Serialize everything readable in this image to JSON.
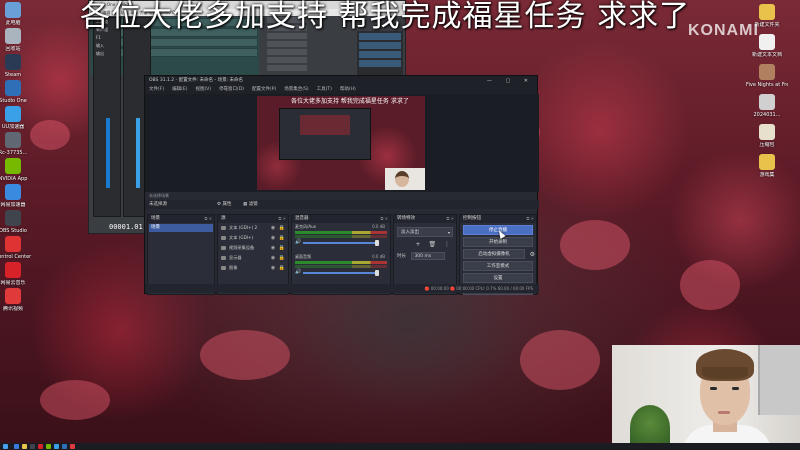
{
  "overlay": {
    "banner_text": "各位大佬多加支持 帮我完成福星任务 求求了",
    "watermark": "KONAMI"
  },
  "desktop_icons_left": [
    {
      "label": "此电脑",
      "icon": "computer-icon",
      "color": "#6aa0d8"
    },
    {
      "label": "回收站",
      "icon": "recycle-bin-icon",
      "color": "#aab4be"
    },
    {
      "label": "Steam",
      "icon": "steam-icon",
      "color": "#2a3a55"
    },
    {
      "label": "Studio One",
      "icon": "studio-one-icon",
      "color": "#2f6fb8"
    },
    {
      "label": "UU加速器",
      "icon": "uu-icon",
      "color": "#3aa0e8"
    },
    {
      "label": "Rc-37735...",
      "icon": "rc-icon",
      "color": "#606874"
    },
    {
      "label": "NVIDIA App",
      "icon": "nvidia-icon",
      "color": "#76b900"
    },
    {
      "label": "网易加速器",
      "icon": "accelerator-icon",
      "color": "#3a8ae0"
    },
    {
      "label": "OBS Studio",
      "icon": "obs-icon",
      "color": "#40444c"
    },
    {
      "label": "Control Center",
      "icon": "control-center-icon",
      "color": "#d33"
    },
    {
      "label": "网易云音乐",
      "icon": "music-icon",
      "color": "#d8222a"
    },
    {
      "label": "腾讯视频",
      "icon": "video-icon",
      "color": "#e03a3a"
    }
  ],
  "desktop_icons_right": [
    {
      "label": "新建文件夹",
      "icon": "folder-icon",
      "color": "#e8c24a"
    },
    {
      "label": "新建文本文档",
      "icon": "text-file-icon",
      "color": "#f0f0f0"
    },
    {
      "label": "Five Nights at Freddy's",
      "icon": "fnaf-icon",
      "color": "#b08060"
    },
    {
      "label": "2024031...",
      "icon": "image-file-icon",
      "color": "#d0d0d0"
    },
    {
      "label": "压缩包",
      "icon": "archive-icon",
      "color": "#e6e0cc"
    },
    {
      "label": "游戏集",
      "icon": "game-folder-icon",
      "color": "#e8c24a"
    }
  ],
  "daw": {
    "title": "Studio One - 无标题",
    "menu": "文件  编辑  歌曲  轨道  事件  传输  视图  Studio One  帮助",
    "time_counter": "00001.01.01.00",
    "channel_buttons": [
      "二声道",
      "单声道",
      "F1",
      "输入",
      "输出"
    ]
  },
  "obs": {
    "title": "OBS 31.1.2 - 配置文件: 未命名 - 场景: 未命名",
    "window_controls": "—  ▢  ✕",
    "menu": [
      "文件(F)",
      "编辑(E)",
      "视图(V)",
      "停靠窗口(D)",
      "配置文件(P)",
      "场景集合(S)",
      "工具(T)",
      "帮助(H)"
    ],
    "preview_caption": "各位大佬多加支持 帮我完成福星任务 求求了",
    "scene_bar_text": "未选择场景",
    "tabs": {
      "left": "未选择源",
      "props": "属性",
      "filters": "滤镜"
    },
    "scenes": {
      "title": "场景",
      "items": [
        "场景"
      ],
      "footer": "+ 🗑 ◧ ∧ ∨"
    },
    "sources": {
      "title": "源",
      "items": [
        {
          "name": "文本 (GDI+) 2",
          "icon": "text-source-icon"
        },
        {
          "name": "文本 (GDI+)",
          "icon": "text-source-icon"
        },
        {
          "name": "视频采集设备",
          "icon": "camera-source-icon"
        },
        {
          "name": "显示器",
          "icon": "display-source-icon"
        },
        {
          "name": "图像",
          "icon": "image-source-icon"
        }
      ],
      "footer": "+ 🗑 ⚙ ∧ ∨"
    },
    "mixer": {
      "title": "混音器",
      "channels": [
        {
          "name": "麦克风/Aux",
          "db": "0.0 dB"
        },
        {
          "name": "桌面音频",
          "db": "0.0 dB"
        }
      ],
      "footer": "⚙ ⋮"
    },
    "transitions": {
      "title": "转场特效",
      "selected": "淡入淡出",
      "duration_label": "时长",
      "duration_value": "300 ms"
    },
    "controls": {
      "title": "控制按钮",
      "buttons": [
        "停止直播",
        "开始录制",
        "启动虚拟摄像机",
        "工作室模式",
        "设置",
        "退出"
      ]
    },
    "status": "🔴 00:00:00   🔴 00:00:00   CPU: 0.7%   60.00 / 60.00 FPS"
  },
  "taskbar_colors": [
    "#3a7ad8",
    "#e8c24a",
    "#40444c",
    "#d8222a",
    "#76b900",
    "#3aa0e8",
    "#2f6fb8",
    "#e03a3a"
  ]
}
